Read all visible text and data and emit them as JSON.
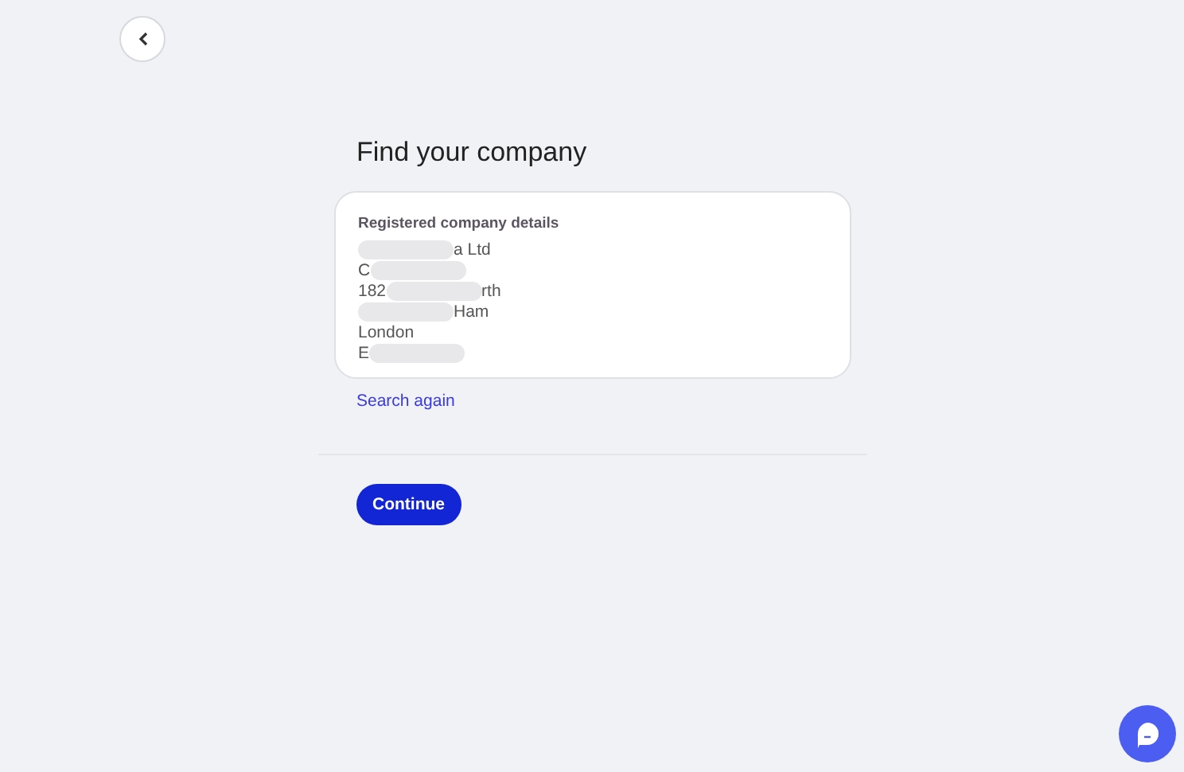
{
  "title": "Find your company",
  "card": {
    "label": "Registered company details",
    "lines": [
      [
        {
          "kind": "redacted"
        },
        {
          "kind": "text",
          "text": "a Ltd"
        }
      ],
      [
        {
          "kind": "text",
          "text": "C"
        },
        {
          "kind": "redacted"
        }
      ],
      [
        {
          "kind": "text",
          "text": "182"
        },
        {
          "kind": "redacted"
        },
        {
          "kind": "text",
          "text": "rth"
        }
      ],
      [
        {
          "kind": "redacted"
        },
        {
          "kind": "text",
          "text": "Ham"
        }
      ],
      [
        {
          "kind": "text",
          "text": "London"
        }
      ],
      [
        {
          "kind": "text",
          "text": "E"
        },
        {
          "kind": "redacted"
        }
      ]
    ]
  },
  "search_again": "Search again",
  "continue": "Continue"
}
